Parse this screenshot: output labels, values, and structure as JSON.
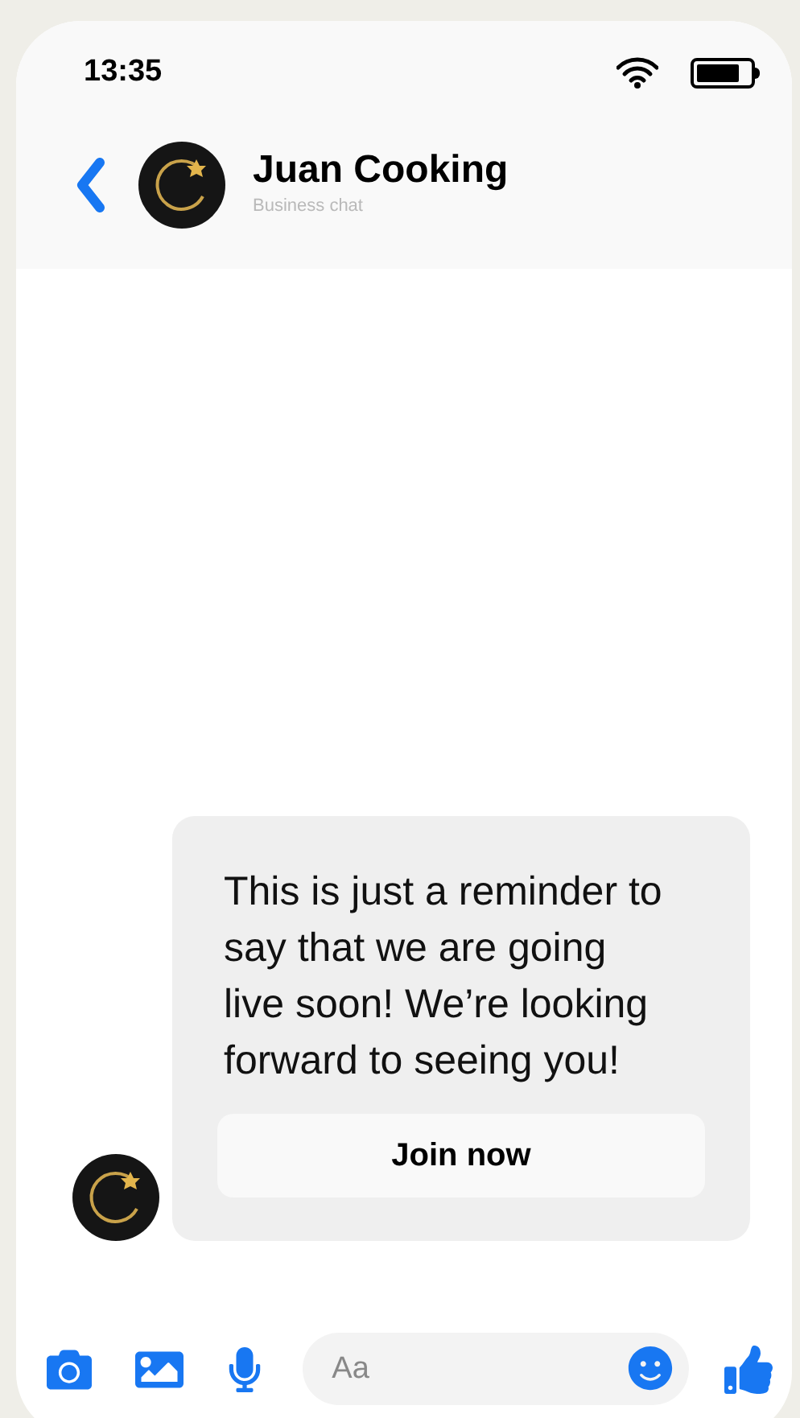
{
  "status_bar": {
    "time": "13:35"
  },
  "header": {
    "title": "Juan Cooking",
    "subtitle": "Business chat"
  },
  "messages": [
    {
      "text": "This is just a reminder to say that we are going live soon! We’re looking forward to seeing you!",
      "button": "Join now"
    }
  ],
  "composer": {
    "placeholder": "Aa"
  }
}
